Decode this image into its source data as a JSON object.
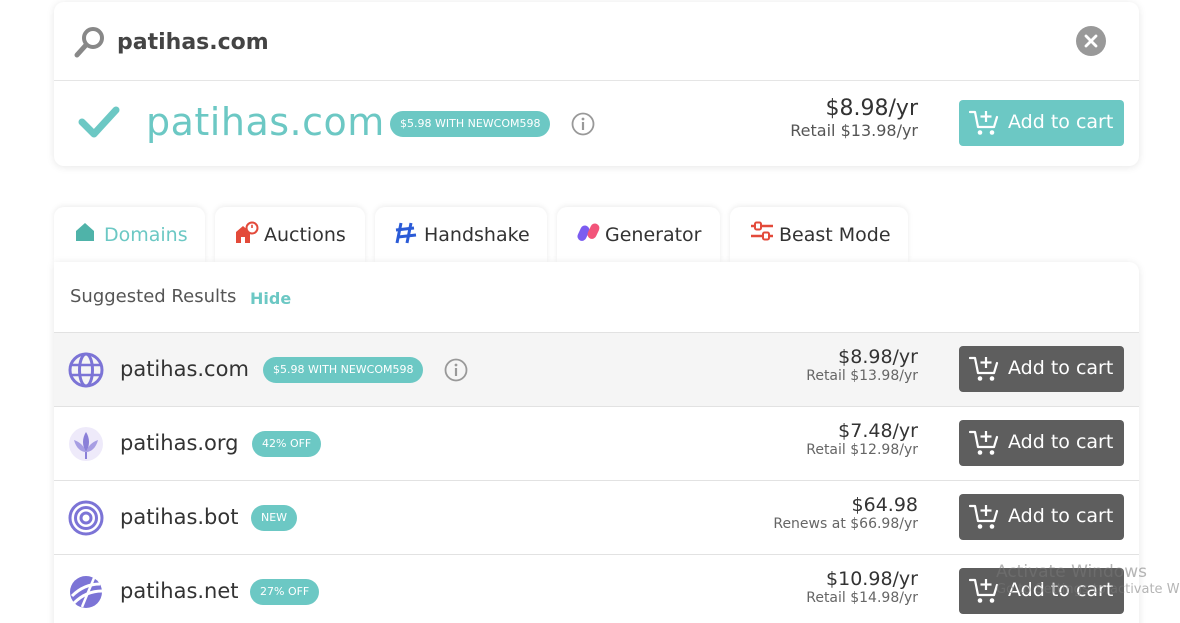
{
  "search": {
    "query": "patihas.com"
  },
  "featured": {
    "domain": "patihas.com",
    "promo": "$5.98 WITH NEWCOM598",
    "price": "$8.98/yr",
    "retail": "Retail $13.98/yr",
    "cart_label": "Add to cart"
  },
  "tabs": [
    {
      "label": "Domains",
      "active": true,
      "icon": "home-icon"
    },
    {
      "label": "Auctions",
      "active": false,
      "icon": "auction-house-icon"
    },
    {
      "label": "Handshake",
      "active": false,
      "icon": "handshake-icon"
    },
    {
      "label": "Generator",
      "active": false,
      "icon": "generator-icon"
    },
    {
      "label": "Beast Mode",
      "active": false,
      "icon": "sliders-icon"
    }
  ],
  "suggested": {
    "title": "Suggested Results",
    "hide_label": "Hide"
  },
  "results": [
    {
      "domain": "patihas.com",
      "badge": "$5.98 WITH NEWCOM598",
      "info": true,
      "price": "$8.98/yr",
      "sub": "Retail $13.98/yr",
      "cart_label": "Add to cart",
      "icon": "globe-icon"
    },
    {
      "domain": "patihas.org",
      "badge": "42% OFF",
      "info": false,
      "price": "$7.48/yr",
      "sub": "Retail $12.98/yr",
      "cart_label": "Add to cart",
      "icon": "lotus-icon"
    },
    {
      "domain": "patihas.bot",
      "badge": "NEW",
      "info": false,
      "price": "$64.98",
      "sub": "Renews at $66.98/yr",
      "cart_label": "Add to cart",
      "icon": "target-icon"
    },
    {
      "domain": "patihas.net",
      "badge": "27% OFF",
      "info": false,
      "price": "$10.98/yr",
      "sub": "Retail $14.98/yr",
      "cart_label": "Add to cart",
      "icon": "net-globe-icon"
    }
  ],
  "watermark": {
    "line1": "Activate Windows",
    "line2": "Go to Settings to activate W"
  },
  "colors": {
    "accent": "#6cc8c4",
    "cart_dark": "#5e5e5e"
  }
}
